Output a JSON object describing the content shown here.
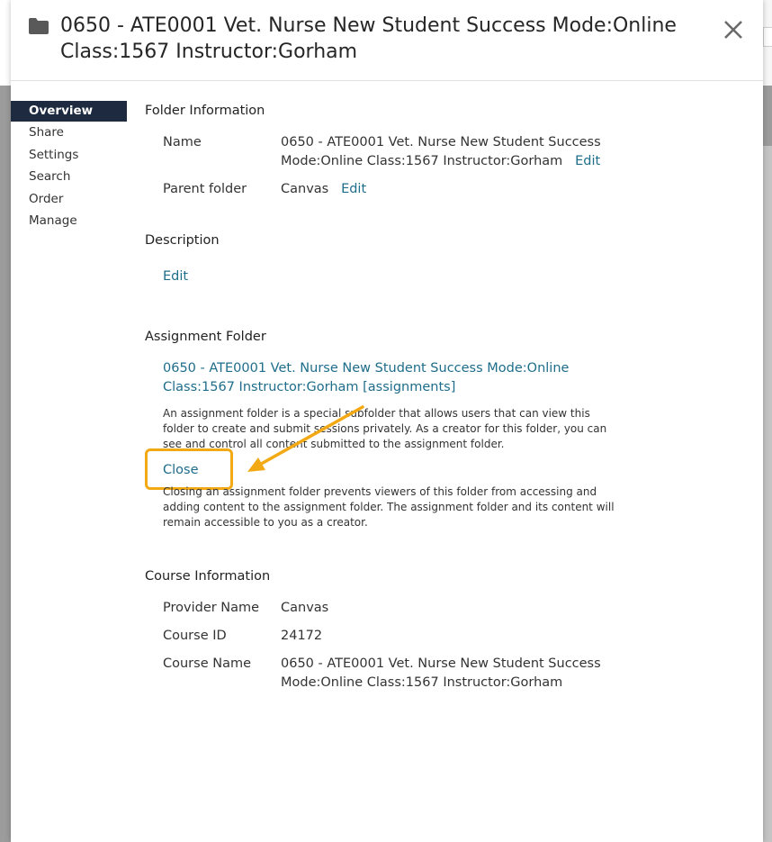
{
  "modal": {
    "title": "0650 - ATE0001 Vet. Nurse New Student Success Mode:Online Class:1567 Instructor:Gorham",
    "close_icon": "close-icon",
    "folder_icon": "folder-icon"
  },
  "sidebar": {
    "items": [
      {
        "label": "Overview",
        "active": true
      },
      {
        "label": "Share"
      },
      {
        "label": "Settings"
      },
      {
        "label": "Search"
      },
      {
        "label": "Order"
      },
      {
        "label": "Manage"
      }
    ]
  },
  "folder_info": {
    "heading": "Folder Information",
    "name_label": "Name",
    "name_value": "0650 - ATE0001 Vet. Nurse New Student Success Mode:Online Class:1567 Instructor:Gorham",
    "name_edit": "Edit",
    "parent_label": "Parent folder",
    "parent_value": "Canvas",
    "parent_edit": "Edit"
  },
  "description": {
    "heading": "Description",
    "edit": "Edit"
  },
  "assignment_folder": {
    "heading": "Assignment Folder",
    "link": "0650 - ATE0001 Vet. Nurse New Student Success Mode:Online Class:1567 Instructor:Gorham [assignments]",
    "explanation": "An assignment folder is a special subfolder that allows users that can view this folder to create and submit sessions privately. As a creator for this folder, you can see and control all content submitted to the assignment folder.",
    "close_label": "Close",
    "close_note": "Closing an assignment folder prevents viewers of this folder from accessing and adding content to the assignment folder. The assignment folder and its content will remain accessible to you as a creator."
  },
  "course_info": {
    "heading": "Course Information",
    "provider_label": "Provider Name",
    "provider_value": "Canvas",
    "course_id_label": "Course ID",
    "course_id_value": "24172",
    "course_name_label": "Course Name",
    "course_name_value": "0650 - ATE0001 Vet. Nurse New Student Success Mode:Online Class:1567 Instructor:Gorham"
  },
  "annotation": {
    "highlight_color": "#f2a914",
    "arrow_icon": "arrow-icon"
  },
  "colors": {
    "link": "#1e6d8a",
    "nav_active_bg": "#1d2a3f"
  }
}
